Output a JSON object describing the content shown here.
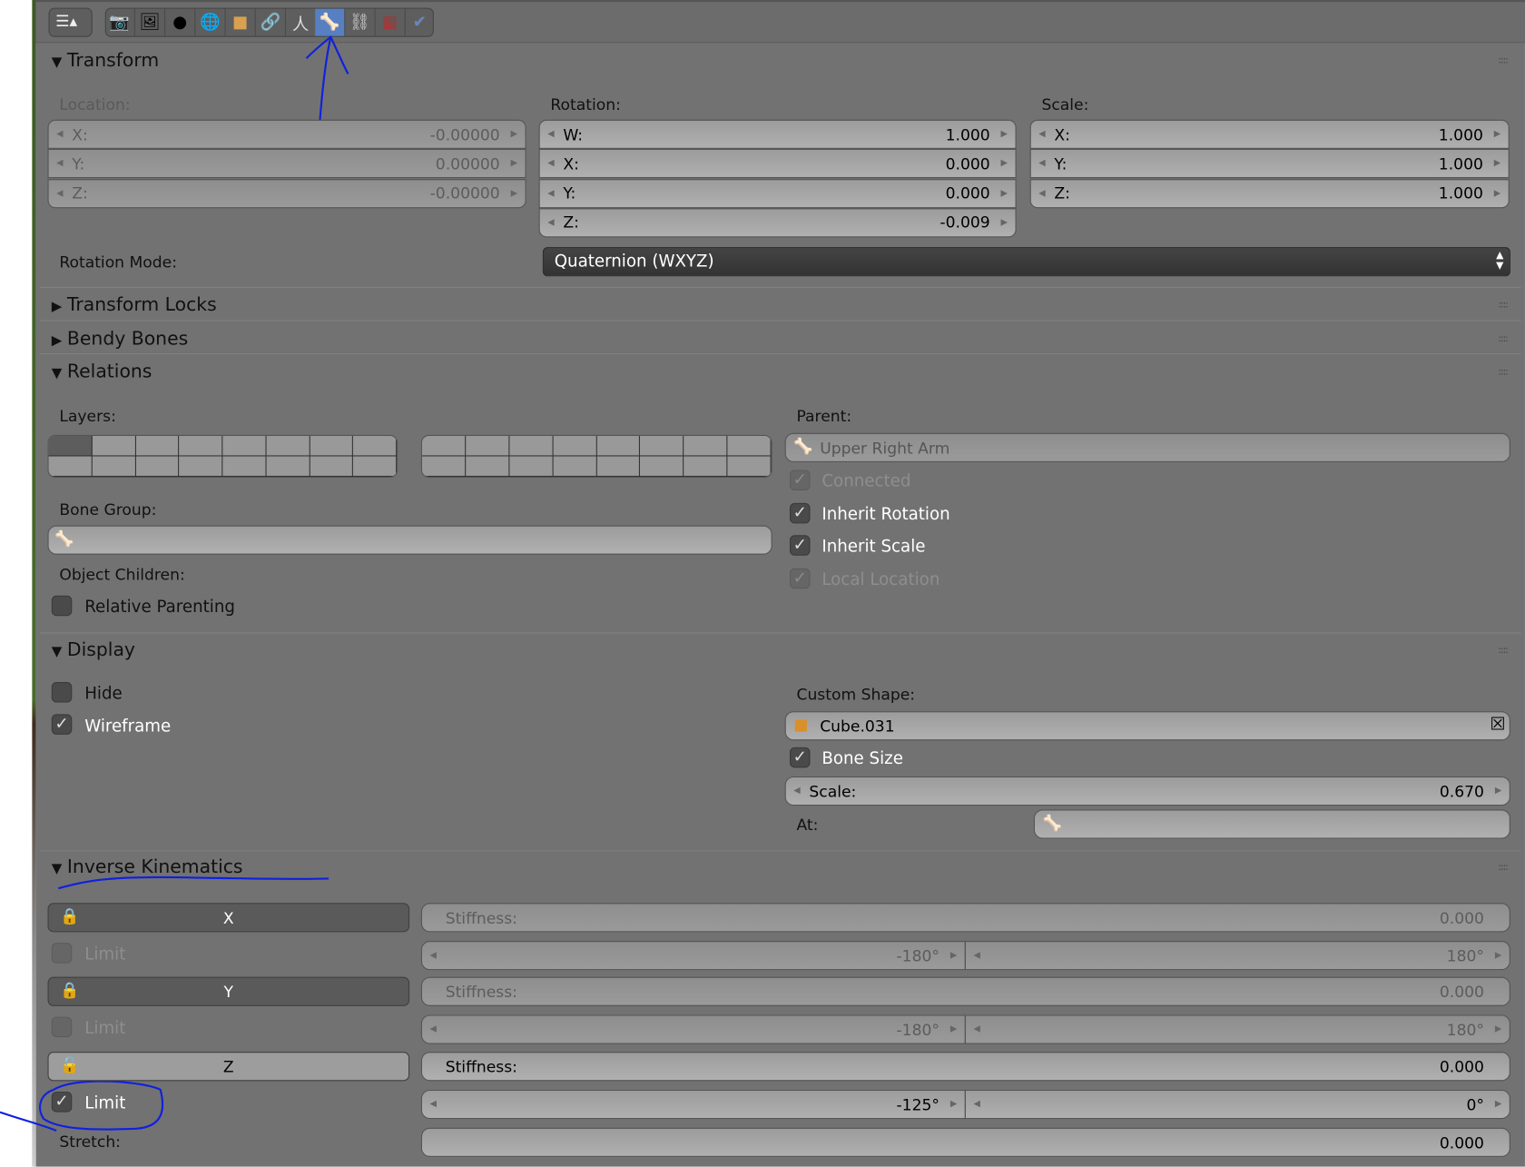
{
  "toolbar": {
    "icons": [
      "render-camera",
      "render-layers",
      "scene",
      "world",
      "object",
      "constraints",
      "object-data",
      "bone",
      "bone-constraints",
      "texture",
      "physics"
    ],
    "active": "bone"
  },
  "panels": {
    "transform": "Transform",
    "transform_locks": "Transform Locks",
    "bendy_bones": "Bendy Bones",
    "relations": "Relations",
    "display": "Display",
    "ik": "Inverse Kinematics"
  },
  "transform": {
    "location_label": "Location:",
    "location": [
      {
        "k": "X:",
        "v": "-0.00000"
      },
      {
        "k": "Y:",
        "v": "0.00000"
      },
      {
        "k": "Z:",
        "v": "-0.00000"
      }
    ],
    "rotation_label": "Rotation:",
    "rotation": [
      {
        "k": "W:",
        "v": "1.000"
      },
      {
        "k": "X:",
        "v": "0.000"
      },
      {
        "k": "Y:",
        "v": "0.000"
      },
      {
        "k": "Z:",
        "v": "-0.009"
      }
    ],
    "scale_label": "Scale:",
    "scale": [
      {
        "k": "X:",
        "v": "1.000"
      },
      {
        "k": "Y:",
        "v": "1.000"
      },
      {
        "k": "Z:",
        "v": "1.000"
      }
    ],
    "rotation_mode_label": "Rotation Mode:",
    "rotation_mode": "Quaternion (WXYZ)"
  },
  "relations": {
    "layers_label": "Layers:",
    "parent_label": "Parent:",
    "parent": "Upper Right Arm",
    "connected": "Connected",
    "inherit_rotation": "Inherit Rotation",
    "inherit_scale": "Inherit Scale",
    "local_location": "Local Location",
    "bone_group_label": "Bone Group:",
    "object_children_label": "Object Children:",
    "relative_parenting": "Relative Parenting"
  },
  "display": {
    "hide": "Hide",
    "wireframe": "Wireframe",
    "custom_shape_label": "Custom Shape:",
    "custom_shape": "Cube.031",
    "bone_size": "Bone Size",
    "scale_label": "Scale:",
    "scale": "0.670",
    "at_label": "At:"
  },
  "ik": {
    "x": "X",
    "y": "Y",
    "z": "Z",
    "stiffness_label": "Stiffness:",
    "limit": "Limit",
    "x_stiffness": "0.000",
    "x_min": "-180°",
    "x_max": "180°",
    "y_stiffness": "0.000",
    "y_min": "-180°",
    "y_max": "180°",
    "z_stiffness": "0.000",
    "z_min": "-125°",
    "z_max": "0°",
    "stretch_label": "Stretch:",
    "stretch": "0.000"
  }
}
